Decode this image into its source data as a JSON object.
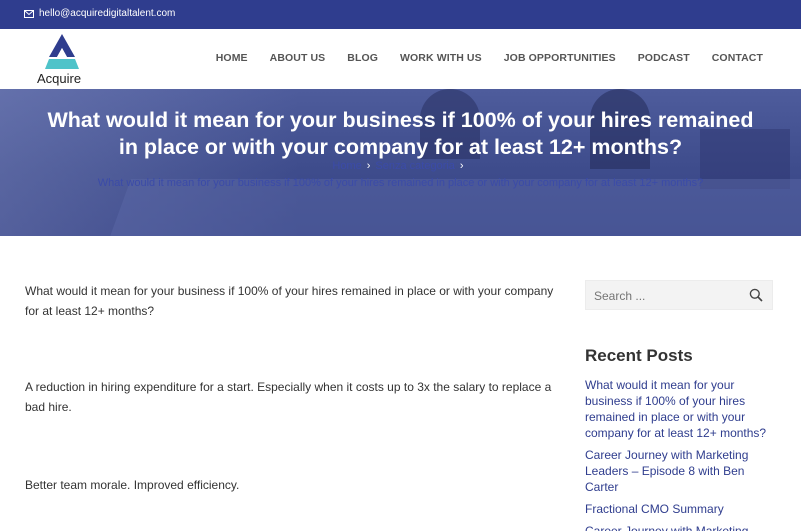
{
  "topbar": {
    "email": "hello@acquiredigitaltalent.com",
    "icon": "envelope-icon"
  },
  "header": {
    "logo_text": "Acquire",
    "nav": [
      "HOME",
      "ABOUT US",
      "BLOG",
      "WORK WITH US",
      "JOB OPPORTUNITIES",
      "PODCAST",
      "CONTACT"
    ]
  },
  "hero": {
    "title_line1": "What would it mean for your business if 100% of your hires remained",
    "title_line2": "in place or with your company for at least 12+ months?",
    "breadcrumb": [
      "Home",
      "Senza categoria"
    ],
    "breadcrumb_current": "What would it mean for your business if 100% of your hires remained in place or with your company for at least 12+ months?"
  },
  "article": {
    "paragraphs": [
      "What would it mean for your business if 100% of your hires remained in place or with your company for at least 12+ months?",
      "A reduction in hiring expenditure for a start. Especially when it costs up to 3x the salary to replace a bad hire.",
      "Better team morale. Improved efficiency."
    ]
  },
  "sidebar": {
    "search_placeholder": "Search ...",
    "recent_title": "Recent Posts",
    "recent_posts": [
      "What would it mean for your business if 100% of your hires remained in place or with your company for at least 12+ months?",
      "Career Journey with Marketing Leaders – Episode 8 with Ben Carter",
      "Fractional CMO Summary",
      "Career Journey with Marketing"
    ]
  },
  "colors": {
    "brand": "#2f3d8e",
    "link": "#2f3d8e",
    "logo_teal": "#4fc3c9"
  }
}
